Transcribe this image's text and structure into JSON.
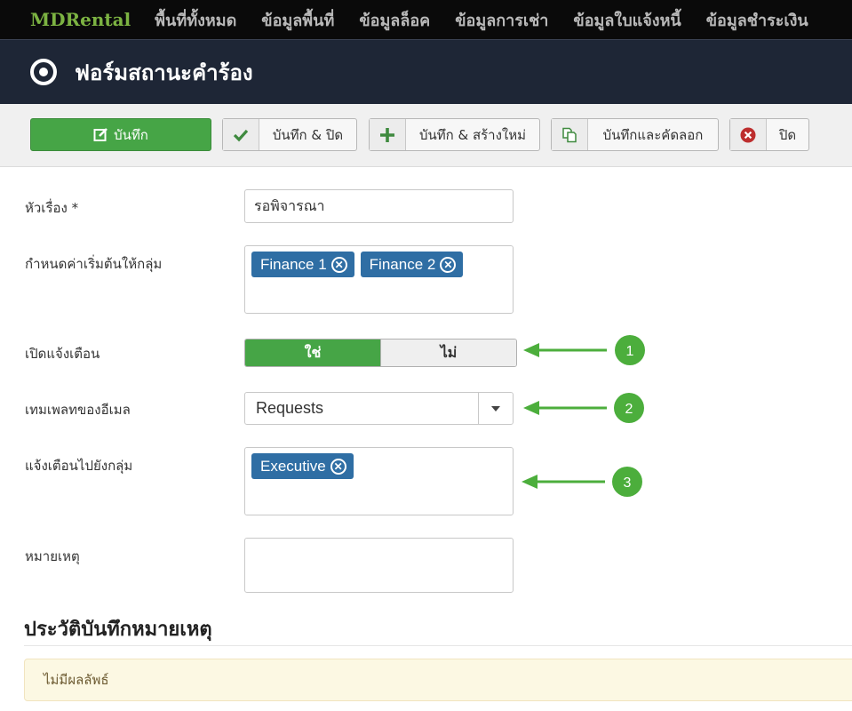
{
  "navbar": {
    "brand": "MDRental",
    "items": [
      "พื้นที่ทั้งหมด",
      "ข้อมูลพื้นที่",
      "ข้อมูลล็อค",
      "ข้อมูลการเช่า",
      "ข้อมูลใบแจ้งหนี้",
      "ข้อมูลชำระเงิน"
    ]
  },
  "header": {
    "title": "ฟอร์มสถานะคำร้อง",
    "icon": "target-icon"
  },
  "toolbar": {
    "save": "บันทึก",
    "save_close": "บันทึก & ปิด",
    "save_new": "บันทึก & สร้างใหม่",
    "save_copy": "บันทึกและคัดลอก",
    "close": "ปิด"
  },
  "form": {
    "title": {
      "label": "หัวเรื่อง *",
      "value": "รอพิจารณา"
    },
    "default_groups": {
      "label": "กำหนดค่าเริ่มต้นให้กลุ่ม",
      "chips": [
        "Finance 1",
        "Finance 2"
      ]
    },
    "notify": {
      "label": "เปิดแจ้งเตือน",
      "yes": "ใช่",
      "no": "ไม่",
      "selected": "ใช่"
    },
    "email_template": {
      "label": "เทมเพลทของอีเมล",
      "value": "Requests"
    },
    "notify_groups": {
      "label": "แจ้งเตือนไปยังกลุ่ม",
      "chips": [
        "Executive"
      ]
    },
    "note": {
      "label": "หมายเหตุ",
      "value": ""
    }
  },
  "history": {
    "title": "ประวัติบันทึกหมายเหตุ",
    "empty_message": "ไม่มีผลลัพธ์"
  },
  "callouts": [
    "1",
    "2",
    "3"
  ],
  "colors": {
    "success": "#46a546",
    "chip": "#2f6ea4",
    "callout": "#4cae3c",
    "header_bg": "#1e2636"
  }
}
